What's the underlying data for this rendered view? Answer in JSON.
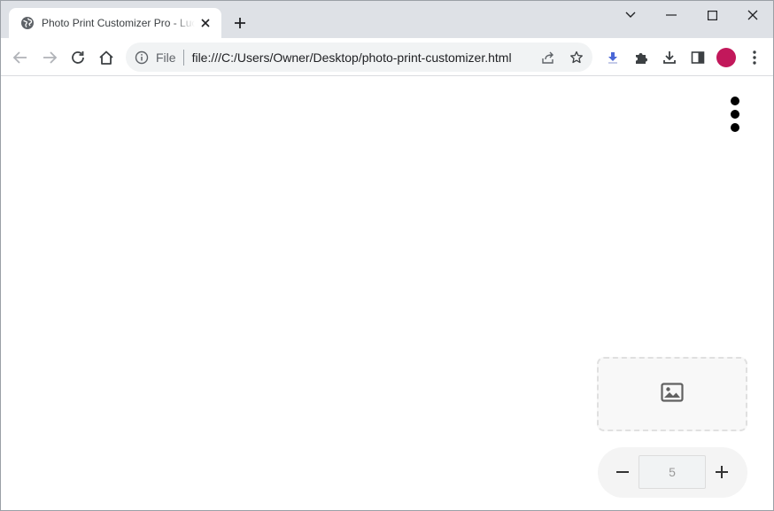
{
  "browser": {
    "tab": {
      "title": "Photo Print Customizer Pro - Lucy"
    },
    "address_bar": {
      "scheme": "File",
      "url": "file:///C:/Users/Owner/Desktop/photo-print-customizer.html"
    },
    "profile_color": "#c2185b"
  },
  "page": {
    "quantity": {
      "value": "5"
    }
  }
}
